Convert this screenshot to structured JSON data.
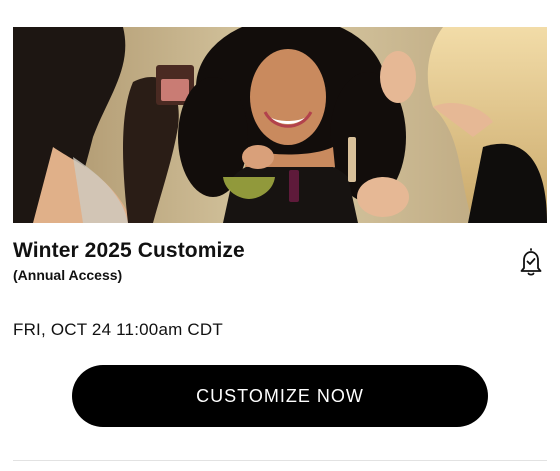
{
  "event": {
    "title": "Winter 2025 Customize",
    "subtitle": "(Annual Access)",
    "date": "FRI, OCT 24 11:00am CDT",
    "cta_label": "CUSTOMIZE NOW"
  },
  "hero": {
    "image_alt": "Group of friends applying makeup"
  },
  "icons": {
    "reminder": "bell-icon"
  },
  "colors": {
    "cta_background": "#000000",
    "cta_text": "#ffffff",
    "text": "#111111",
    "divider": "#e2e2e2"
  }
}
